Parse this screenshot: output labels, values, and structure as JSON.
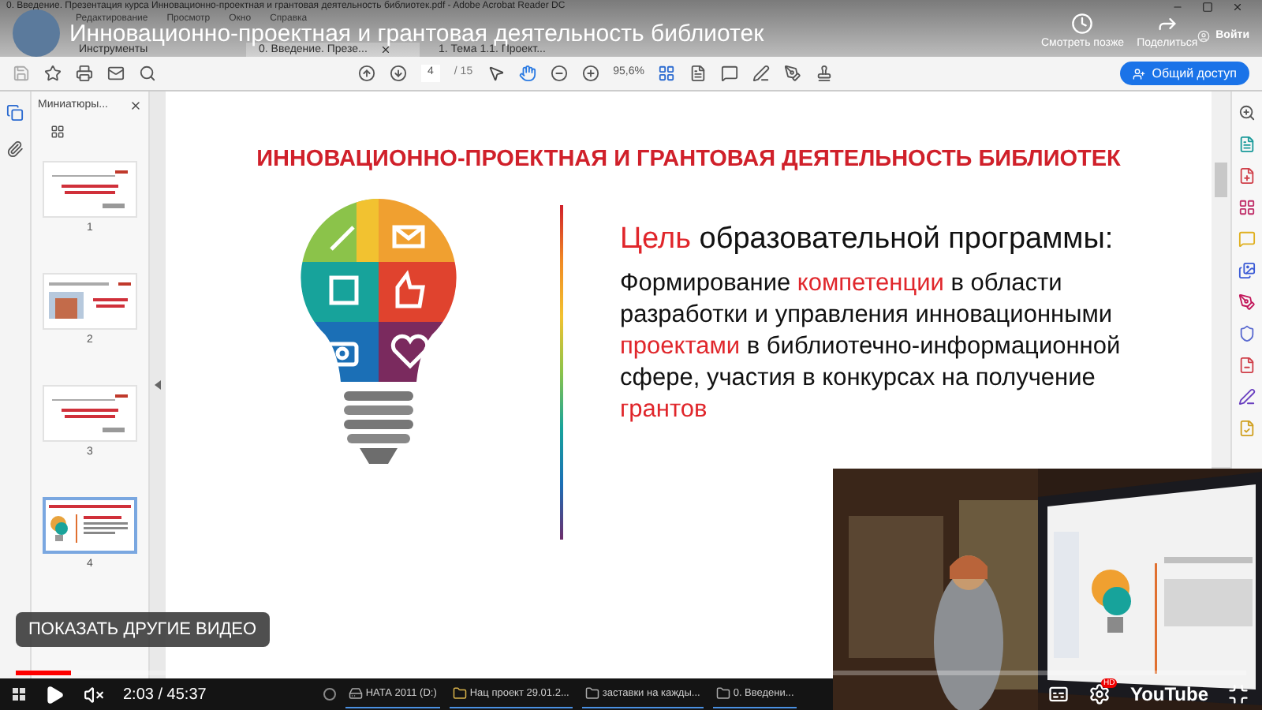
{
  "acrobat": {
    "title": "0. Введение. Презентация курса Инновационно-проектная и грантовая деятельность библиотек.pdf - Adobe Acrobat Reader DC",
    "menu": [
      "Редактирование",
      "Просмотр",
      "Окно",
      "Справка"
    ],
    "sign_in": "Войти",
    "tabs": [
      {
        "label": "Инструменты",
        "selected": false,
        "closable": false
      },
      {
        "label": "0. Введение. Презе...",
        "selected": true,
        "closable": true
      },
      {
        "label": "1. Тема 1.1. Проект...",
        "selected": false,
        "closable": false
      }
    ],
    "page": "4",
    "page_count": "/ 15",
    "tools": [
      {
        "kind": "pointer",
        "selected": false
      },
      {
        "kind": "hand",
        "selected": true
      }
    ],
    "zoom": "95,6%",
    "share_button": "Общий доступ"
  },
  "thumbnails": {
    "title": "Миниатюры...",
    "pages": [
      {
        "number": "1",
        "kind": "title",
        "selected": false
      },
      {
        "number": "2",
        "selected": false
      },
      {
        "number": "3",
        "kind": "title",
        "selected": false
      },
      {
        "number": "4",
        "kind": "bulb",
        "selected": true
      }
    ]
  },
  "slide": {
    "heading": "ИННОВАЦИОННО-ПРОЕКТНАЯ И ГРАНТОВАЯ ДЕЯТЕЛЬНОСТЬ БИБЛИОТЕК",
    "goal": [
      {
        "text": "Цель",
        "accent": true
      },
      {
        "text": " образовательной программы:",
        "accent": false
      }
    ],
    "paragraph": [
      {
        "text": "Формирование ",
        "accent": false
      },
      {
        "text": "компетенции",
        "accent": true
      },
      {
        "text": " в области разработки и управления инновационными ",
        "accent": false
      },
      {
        "text": "проектами",
        "accent": true
      },
      {
        "text": " в библиотечно-информационной сфере, участия в конкурсах на получение ",
        "accent": false
      },
      {
        "text": "грантов",
        "accent": true
      }
    ]
  },
  "youtube": {
    "title": "Инновационно-проектная и грантовая деятельность библиотек",
    "watch_later": "Смотреть позже",
    "share": "Поделиться",
    "more_videos": "ПОКАЗАТЬ ДРУГИЕ ВИДЕО",
    "progress": {
      "level": 0.045
    },
    "paused": true,
    "muted": true,
    "time": "2:03 / 45:37",
    "quality_badge": "HD",
    "logo": "YouTube"
  },
  "taskbar": [
    "НАТА 2011 (D:)",
    "Нац проект 29.01.2...",
    "заставки на кажды...",
    "0. Введени..."
  ]
}
